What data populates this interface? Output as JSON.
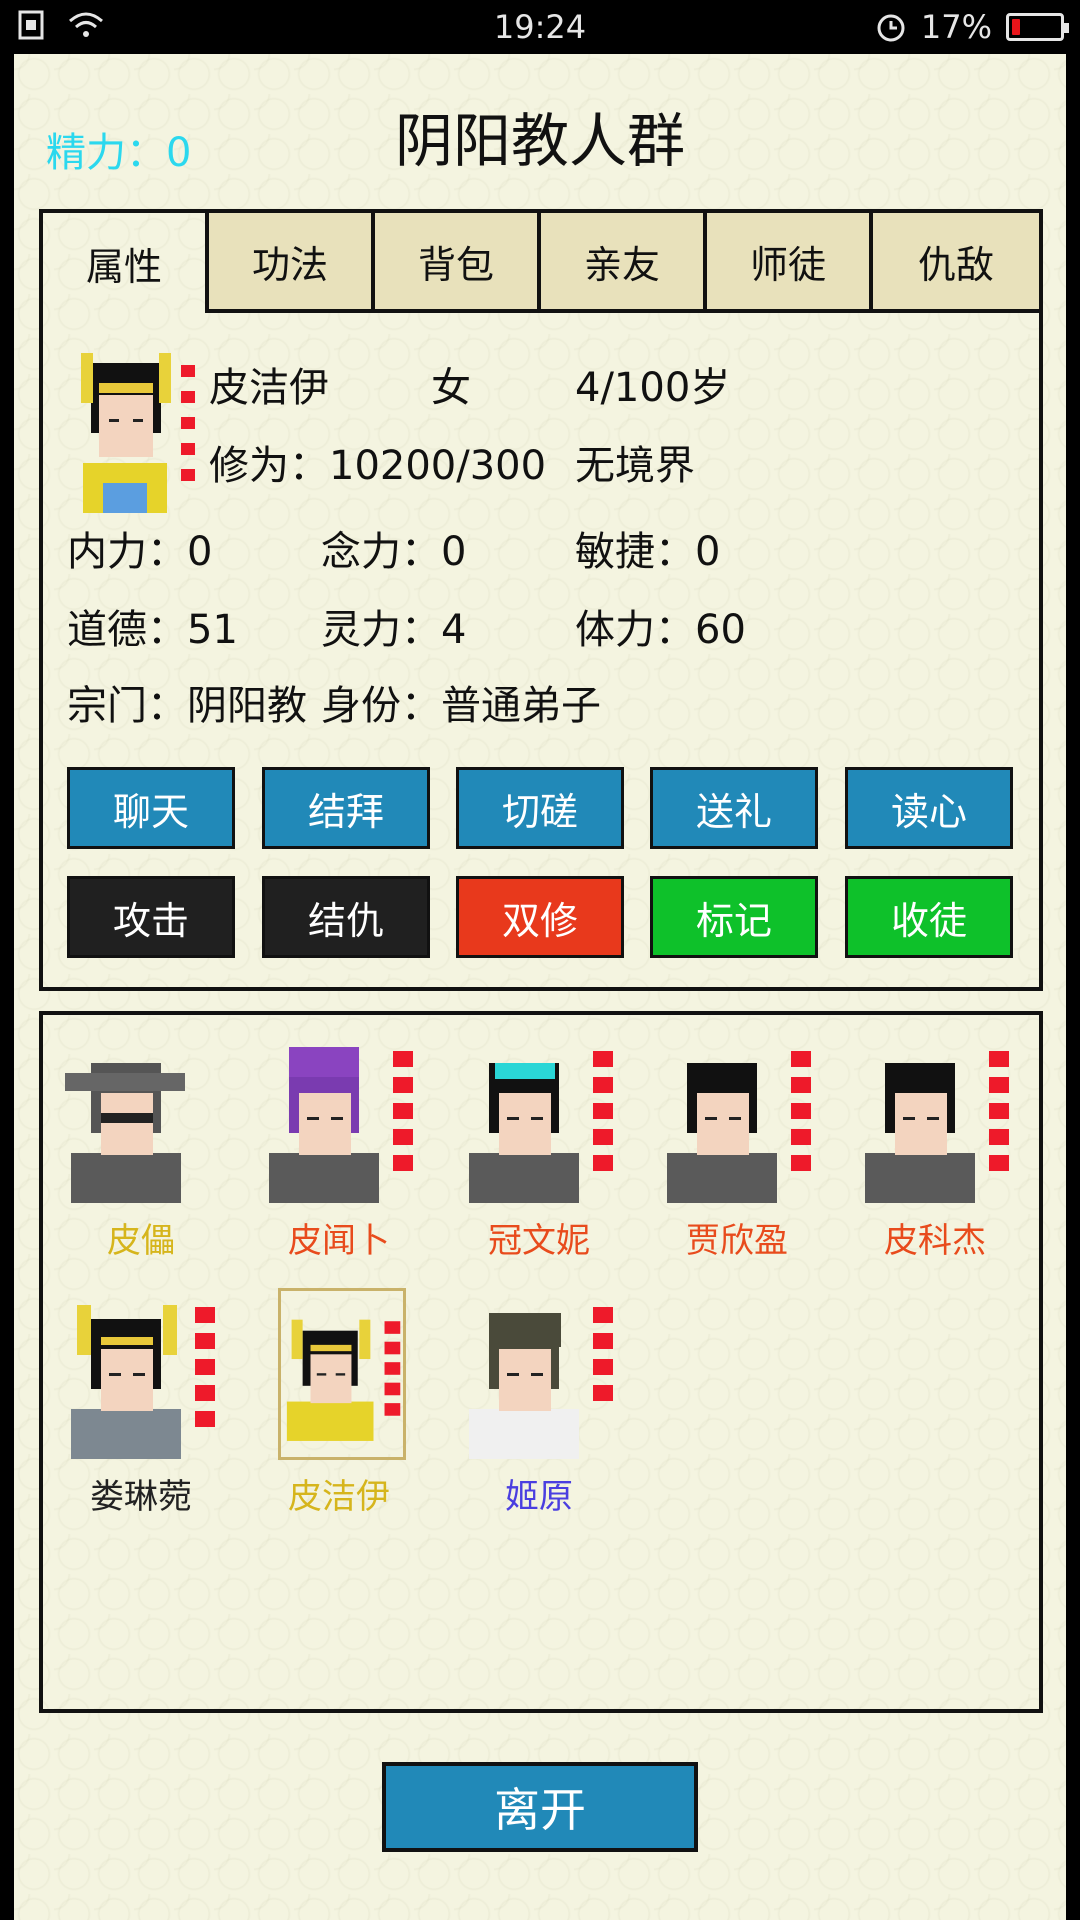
{
  "status_bar": {
    "time": "19:24",
    "battery": "17%",
    "battery_level": 0.17
  },
  "header": {
    "energy_label": "精力：",
    "energy_value": "0",
    "title": "阴阳教人群"
  },
  "tabs": [
    "属性",
    "功法",
    "背包",
    "亲友",
    "师徒",
    "仇敌"
  ],
  "character": {
    "name": "皮洁伊",
    "gender": "女",
    "age": "4/100岁",
    "cultivation": "修为：10200/300",
    "realm": "无境界",
    "stats": {
      "neili": "内力：0",
      "nianli": "念力：0",
      "minjie": "敏捷：0",
      "daode": "道德：51",
      "lingli": "灵力：4",
      "tili": "体力：60",
      "zongmen": "宗门：阴阳教",
      "shenfen": "身份：普通弟子"
    }
  },
  "actions": {
    "row1": [
      "聊天",
      "结拜",
      "切磋",
      "送礼",
      "读心"
    ],
    "row2": [
      "攻击",
      "结仇",
      "双修",
      "标记",
      "收徒"
    ]
  },
  "colors": {
    "accent_blue": "#2189b8",
    "black": "#202020",
    "red": "#e8391c",
    "green": "#0ec12a",
    "energy": "#2bd8ee"
  },
  "npcs": [
    {
      "name": "皮儡",
      "color": "#d6b51c",
      "hearts": 0,
      "hat": "conical"
    },
    {
      "name": "皮闻卜",
      "color": "#e84b1c",
      "hearts": 5,
      "hat": "purple"
    },
    {
      "name": "冠文妮",
      "color": "#e84b1c",
      "hearts": 5,
      "hat": "cyan"
    },
    {
      "name": "贾欣盈",
      "color": "#e84b1c",
      "hearts": 5,
      "hat": "bun"
    },
    {
      "name": "皮科杰",
      "color": "#e84b1c",
      "hearts": 5,
      "hat": "topknot"
    },
    {
      "name": "娄琳菀",
      "color": "#222222",
      "hearts": 5,
      "hat": "crown"
    },
    {
      "name": "皮洁伊",
      "color": "#d6b51c",
      "hearts": 5,
      "hat": "crown",
      "selected": true
    },
    {
      "name": "姬原",
      "color": "#4a3ee0",
      "hearts": 4,
      "hat": "cap"
    }
  ],
  "leave_label": "离开"
}
